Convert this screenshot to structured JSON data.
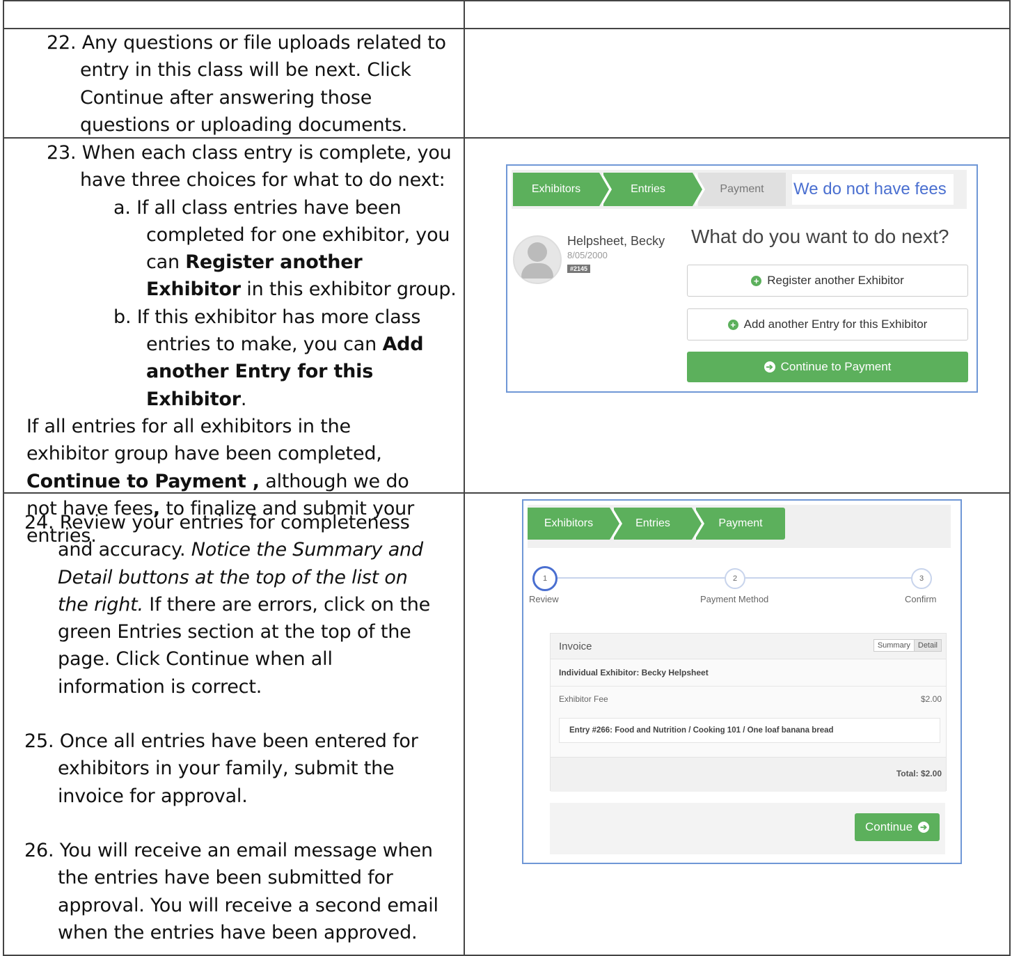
{
  "step22": {
    "text": "22. Any questions or file uploads related to entry in this class will be next. Click Continue after answering those questions or uploading documents."
  },
  "step23": {
    "intro": "23. When each class entry is complete, you have three choices for what to do next:",
    "a_pre": "a. If all class entries have been completed for one exhibitor, you can ",
    "a_bold": "Register another Exhibitor",
    "a_post": " in this exhibitor group.",
    "b_pre": "b. If this exhibitor has more class entries to make, you can ",
    "b_bold": "Add another Entry for this Exhibitor",
    "b_post": ".",
    "c_pre": "If all entries for all exhibitors in the exhibitor group have been completed, ",
    "c_bold": "Continue to Payment ,",
    "c_mid": " although we do not have fees",
    "c_comma": ",",
    "c_post": " to finalize and submit your entries."
  },
  "step24": {
    "pre": "24. Review your entries for completeness and accuracy. ",
    "italic": "Notice the Summary and Detail buttons at the top of the list on the right.",
    "post": " If there are errors, click on the green Entries section at the top of the page. Click Continue when all information is correct."
  },
  "step25": {
    "text": "25. Once all entries have been entered for exhibitors in your family, submit the invoice for approval."
  },
  "step26": {
    "text": "26. You will receive an email message when the entries have been submitted for approval. You will receive a second email when the entries have been approved."
  },
  "shot1": {
    "crumbs": [
      "Exhibitors",
      "Entries",
      "Payment"
    ],
    "note": "We do not have fees",
    "name": "Helpsheet, Becky",
    "dob": "8/05/2000",
    "id_badge": "#2145",
    "heading": "What do you want to do next?",
    "btn_register": "Register another Exhibitor",
    "btn_add": "Add another Entry for this Exhibitor",
    "btn_continue": "Continue to Payment"
  },
  "shot2": {
    "crumbs": [
      "Exhibitors",
      "Entries",
      "Payment"
    ],
    "steps": [
      {
        "num": "1",
        "label": "Review"
      },
      {
        "num": "2",
        "label": "Payment Method"
      },
      {
        "num": "3",
        "label": "Confirm"
      }
    ],
    "invoice_title": "Invoice",
    "summary_btn": "Summary",
    "detail_btn": "Detail",
    "exhibitor_header": "Individual Exhibitor: Becky Helpsheet",
    "fee_label": "Exhibitor Fee",
    "fee_value": "$2.00",
    "entry_line": "Entry #266: Food and Nutrition / Cooking 101 / One loaf banana bread",
    "total": "Total: $2.00",
    "continue_btn": "Continue"
  },
  "colors": {
    "green": "#5cb05c",
    "border_blue": "#6f97d6",
    "note_blue": "#4a6fd0"
  }
}
